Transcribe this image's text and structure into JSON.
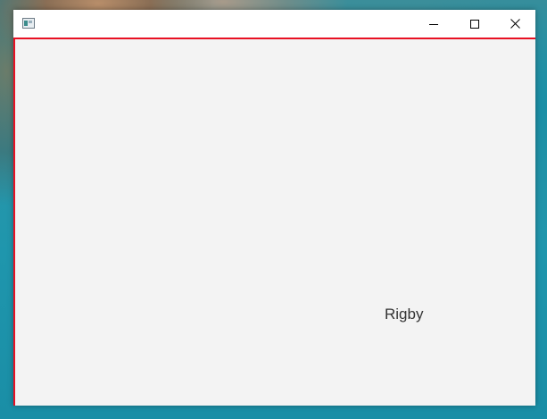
{
  "window": {
    "title": "",
    "app_icon": "window-app-icon",
    "controls": {
      "minimize_icon": "minimize-icon",
      "maximize_icon": "maximize-icon",
      "close_icon": "close-icon"
    },
    "accent_border_color": "#e81123"
  },
  "content": {
    "label": "Rigby"
  }
}
